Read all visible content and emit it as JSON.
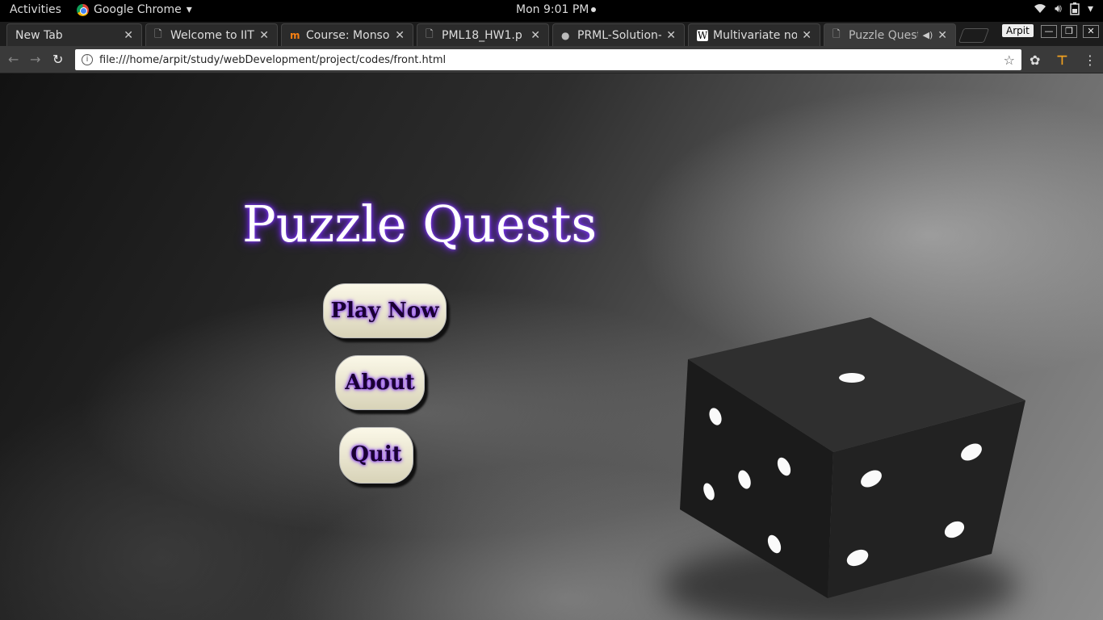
{
  "topbar": {
    "activities": "Activities",
    "app_name": "Google Chrome",
    "clock": "Mon  9:01 PM"
  },
  "tabs": [
    {
      "label": "New Tab",
      "icon": "none"
    },
    {
      "label": "Welcome to IIT",
      "icon": "page-icon"
    },
    {
      "label": "Course: Monsoo",
      "icon": "moodle-icon"
    },
    {
      "label": "PML18_HW1.p",
      "icon": "page-icon"
    },
    {
      "label": "PRML-Solution-",
      "icon": "github-icon"
    },
    {
      "label": "Multivariate nor",
      "icon": "wikipedia-icon"
    },
    {
      "label": "Puzzle Quest",
      "icon": "page-icon",
      "active": true
    }
  ],
  "profile": "Arpit",
  "address_bar": {
    "url": "file:///home/arpit/study/webDevelopment/project/codes/front.html"
  },
  "page": {
    "title": "Puzzle Quests",
    "buttons": {
      "play": "Play Now",
      "about": "About",
      "quit": "Quit"
    }
  },
  "colors": {
    "title_glow": "#7b2cff",
    "button_bg": "#f0ecd6",
    "button_text": "#1a0033"
  }
}
